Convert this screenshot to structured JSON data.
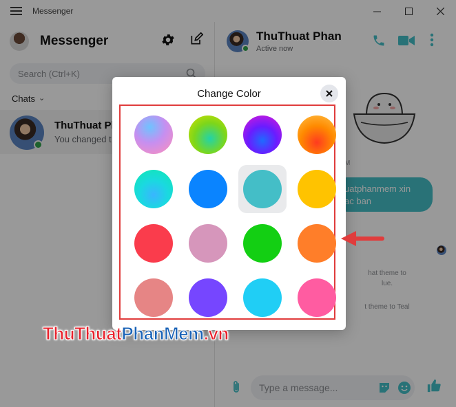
{
  "window": {
    "app_name": "Messenger"
  },
  "sidebar": {
    "title": "Messenger",
    "search_placeholder": "Search (Ctrl+K)",
    "filter_label": "Chats",
    "conversation": {
      "name": "ThuThuat Ph",
      "preview": "You changed t"
    }
  },
  "chat": {
    "contact_name": "ThuThuat Phan",
    "status": "Active now",
    "timestamp_fragment": "M",
    "bubble_line1": "uatphanmem xin",
    "bubble_line2": "ac ban",
    "system_line1": "hat theme to",
    "system_line2": "lue.",
    "system_line3": "t theme to Teal",
    "composer_placeholder": "Type a message..."
  },
  "modal": {
    "title": "Change Color",
    "swatches": [
      {
        "name": "gradient-berry",
        "color": "#f27aa0"
      },
      {
        "name": "gradient-lime",
        "color": "#6cd11a"
      },
      {
        "name": "gradient-ultraviolet",
        "color": "#8a1df0"
      },
      {
        "name": "gradient-sunset",
        "color": "#ff7a00"
      },
      {
        "name": "gradient-aqua",
        "color": "#00e0d0"
      },
      {
        "name": "blue",
        "color": "#0a84ff"
      },
      {
        "name": "teal",
        "color": "#44bec7",
        "selected": true
      },
      {
        "name": "yellow",
        "color": "#ffc300"
      },
      {
        "name": "red",
        "color": "#fa3c4c"
      },
      {
        "name": "mauve",
        "color": "#d696bb"
      },
      {
        "name": "green",
        "color": "#13cf13"
      },
      {
        "name": "orange",
        "color": "#ff7e29"
      },
      {
        "name": "salmon",
        "color": "#e68585"
      },
      {
        "name": "purple",
        "color": "#7646ff"
      },
      {
        "name": "sky",
        "color": "#20cef5"
      },
      {
        "name": "pink",
        "color": "#ff5ca1"
      }
    ]
  },
  "watermark": {
    "part1": "ThuThuat",
    "part2": "PhanMem",
    "part3": ".vn"
  },
  "colors": {
    "accent_teal": "#44bec7",
    "annotation_red": "#e03c3c",
    "online_green": "#31a24c"
  }
}
